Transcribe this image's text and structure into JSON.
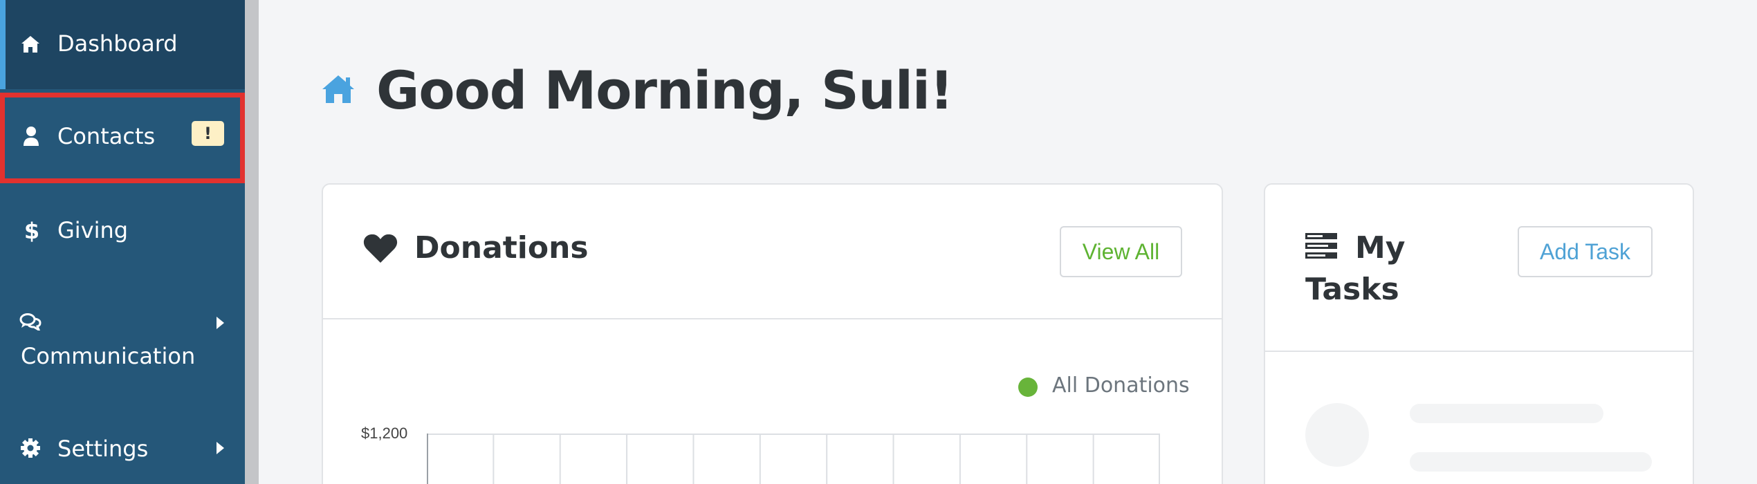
{
  "sidebar": {
    "items": [
      {
        "label": "Dashboard",
        "icon": "home-icon",
        "active": true
      },
      {
        "label": "Contacts",
        "icon": "user-icon",
        "badge": "!",
        "highlighted": true
      },
      {
        "label": "Giving",
        "icon": "dollar-icon"
      },
      {
        "label": "Communication",
        "icon": "comments-icon",
        "has_submenu": true
      },
      {
        "label": "Settings",
        "icon": "gear-icon",
        "has_submenu": true
      }
    ]
  },
  "main": {
    "greeting": "Good Morning, Suli!",
    "greeting_icon": "home-icon"
  },
  "donations": {
    "title": "Donations",
    "title_icon": "heart-icon",
    "view_all_label": "View All",
    "legend_label": "All Donations"
  },
  "tasks": {
    "title": "My Tasks",
    "title_icon": "tasks-list-icon",
    "add_task_label": "Add Task"
  },
  "chart_data": {
    "type": "line",
    "series": [
      {
        "name": "All Donations",
        "values": []
      }
    ],
    "y_tick_labels": [
      "$1,200"
    ],
    "grid": true
  },
  "colors": {
    "sidebar_bg": "#255779",
    "sidebar_active_bg": "#1e4562",
    "active_accent": "#4aa3df",
    "highlight_border": "#e2322f",
    "badge_bg": "#fdf0c6",
    "view_all_text": "#5eb332",
    "add_task_text": "#4fa2d5",
    "legend_dot": "#68b43a"
  }
}
